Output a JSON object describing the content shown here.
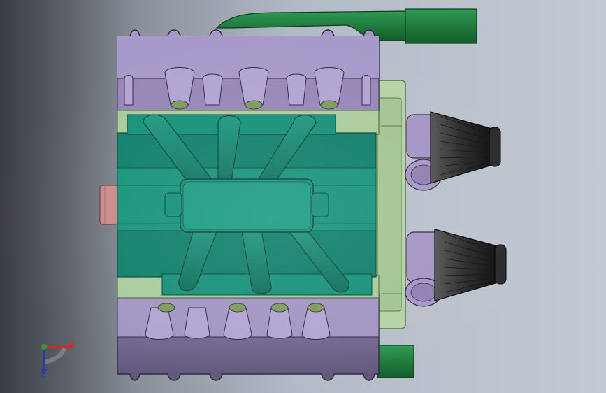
{
  "viewport": {
    "background_left": "#3a3d42",
    "background_right": "#c3cad4"
  },
  "model": {
    "block_color": "#a08fc0",
    "block_shadow_color": "#6f6488",
    "manifold_color": "#18866f",
    "gasket_color": "#a9cc9c",
    "pipe_color": "#1f7a3d",
    "air_filter_color": "#3a3a3a",
    "pulley_color": "#c98a88"
  },
  "triad": {
    "x_label": "X",
    "z_label": "Z",
    "x_color": "#d9262b",
    "y_color": "#2b9a3a",
    "z_color": "#2936b8"
  }
}
